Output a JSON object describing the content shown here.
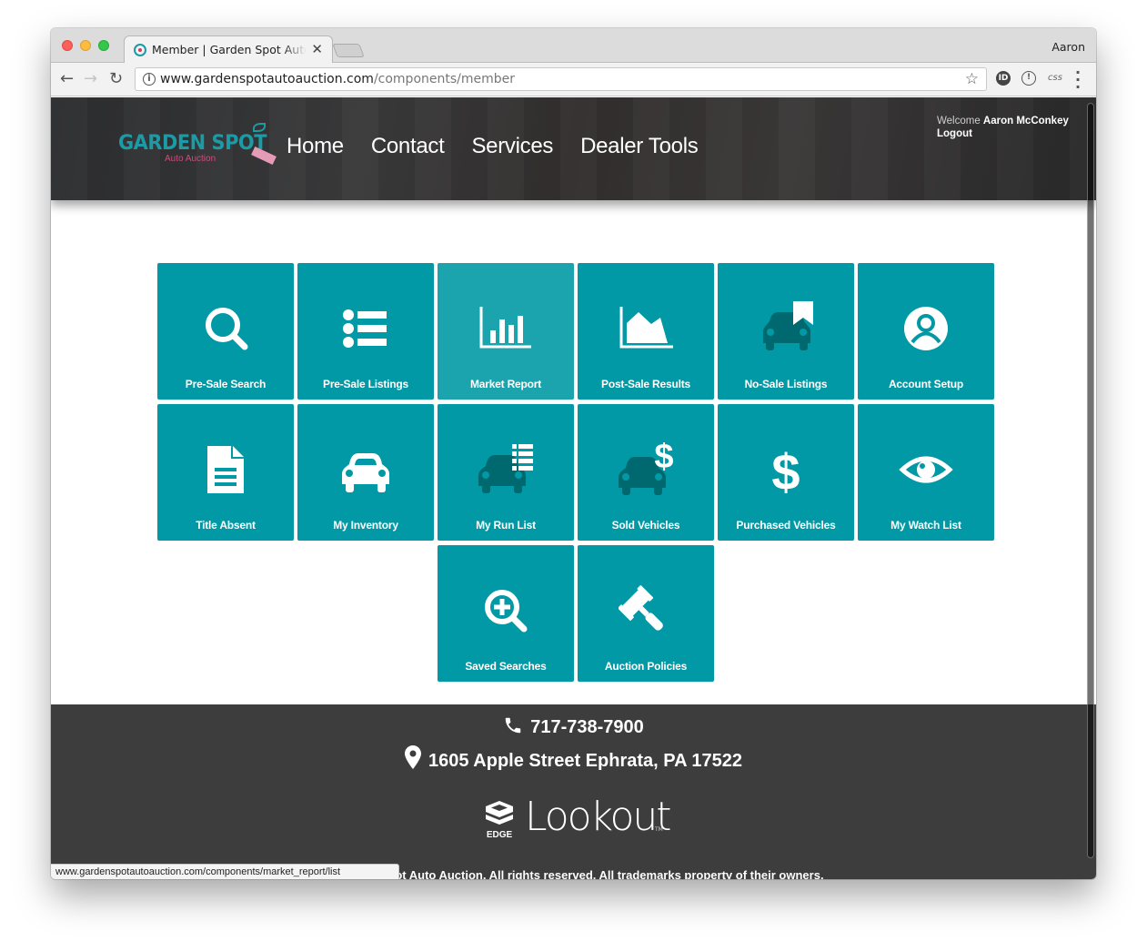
{
  "browser": {
    "tab_title": "Member | Garden Spot Auto Auction",
    "profile_name": "Aaron",
    "url_host": "www.gardenspotautoauction.com",
    "url_path": "/components/member",
    "status_url": "www.gardenspotautoauction.com/components/market_report/list",
    "extensions": [
      "ID",
      "!",
      "css"
    ]
  },
  "site": {
    "logo_main": "GARDEN SPOT",
    "logo_sub": "Auto Auction",
    "nav": [
      "Home",
      "Contact",
      "Services",
      "Dealer Tools"
    ],
    "welcome_prefix": "Welcome",
    "user_name": "Aaron McConkey",
    "logout_label": "Logout"
  },
  "tiles": [
    {
      "label": "Pre-Sale Search",
      "icon": "search-icon"
    },
    {
      "label": "Pre-Sale Listings",
      "icon": "list-icon"
    },
    {
      "label": "Market Report",
      "icon": "bar-chart-icon",
      "hovered": true
    },
    {
      "label": "Post-Sale Results",
      "icon": "area-chart-icon"
    },
    {
      "label": "No-Sale Listings",
      "icon": "car-bookmark-icon"
    },
    {
      "label": "Account Setup",
      "icon": "user-circle-icon"
    },
    {
      "label": "Title Absent",
      "icon": "document-icon"
    },
    {
      "label": "My Inventory",
      "icon": "car-icon"
    },
    {
      "label": "My Run List",
      "icon": "car-list-icon"
    },
    {
      "label": "Sold Vehicles",
      "icon": "car-dollar-icon"
    },
    {
      "label": "Purchased Vehicles",
      "icon": "dollar-icon"
    },
    {
      "label": "My Watch List",
      "icon": "eye-icon"
    },
    {
      "label": "Saved Searches",
      "icon": "search-plus-icon"
    },
    {
      "label": "Auction Policies",
      "icon": "gavel-icon"
    }
  ],
  "colors": {
    "tile": "#0199a5",
    "tile_hover": "#1ba4ad",
    "icon_dark": "#006970",
    "footer": "#3d3d3d"
  },
  "footer": {
    "phone": "717-738-7900",
    "address": "1605 Apple Street Ephrata, PA 17522",
    "brand_badge": "EDGE",
    "brand_name": "Lookout",
    "brand_tm": "TM",
    "copyright": "© Garden Spot Auto Auction. All rights reserved. All trademarks property of their owners."
  }
}
